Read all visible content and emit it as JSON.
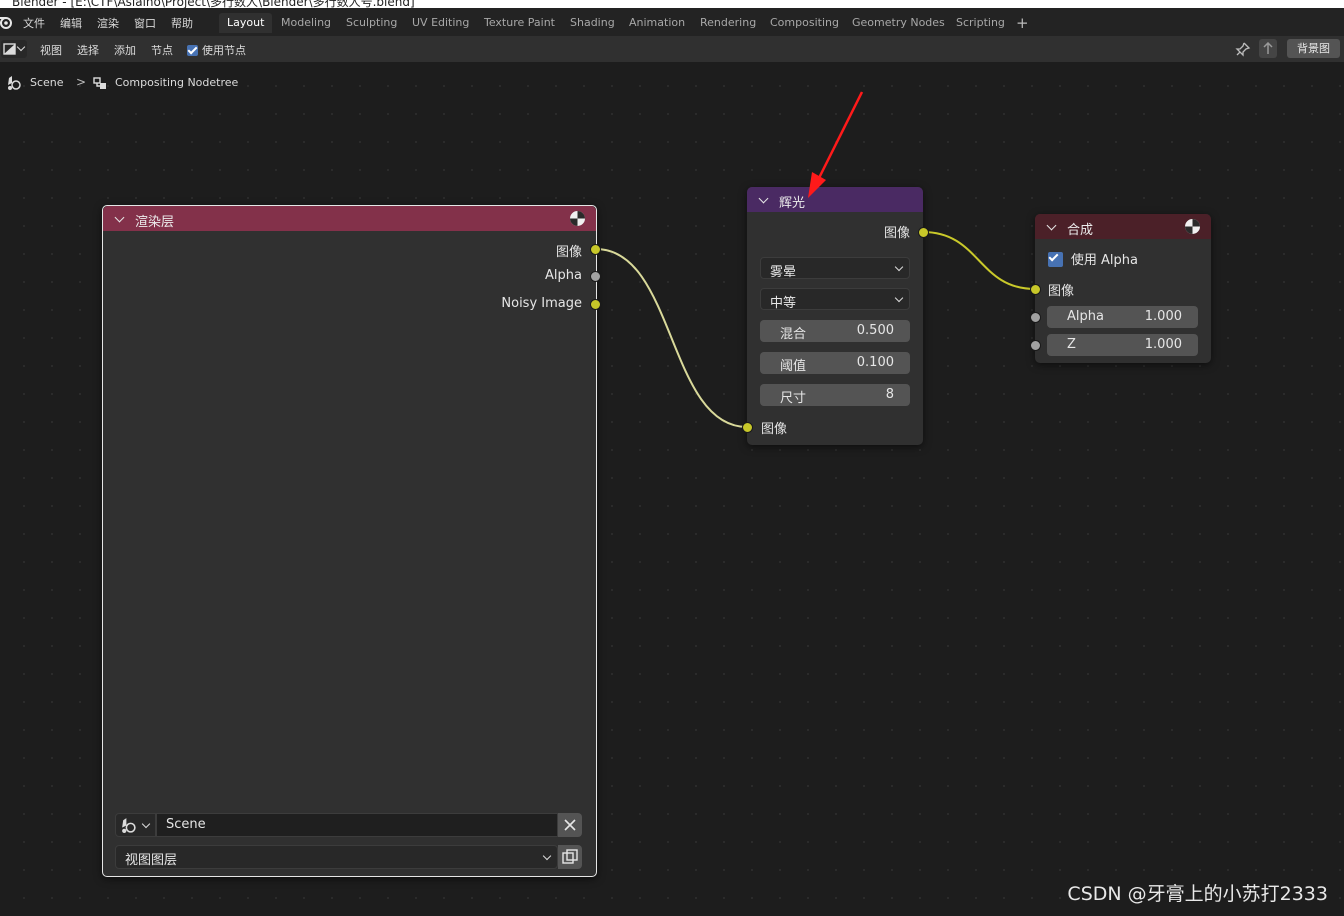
{
  "title_strip": "Blender - [E:\\CTF\\Asiaino\\Project\\多行数人\\Blender\\多行数人号.blend]",
  "menu": [
    "文件",
    "编辑",
    "渲染",
    "窗口",
    "帮助"
  ],
  "workspace_tabs": [
    {
      "label": "Layout",
      "active": true
    },
    {
      "label": "Modeling",
      "active": false
    },
    {
      "label": "Sculpting",
      "active": false
    },
    {
      "label": "UV Editing",
      "active": false
    },
    {
      "label": "Texture Paint",
      "active": false
    },
    {
      "label": "Shading",
      "active": false
    },
    {
      "label": "Animation",
      "active": false
    },
    {
      "label": "Rendering",
      "active": false
    },
    {
      "label": "Compositing",
      "active": false
    },
    {
      "label": "Geometry Nodes",
      "active": false
    },
    {
      "label": "Scripting",
      "active": false
    }
  ],
  "add_workspace": "+",
  "header": {
    "menus": [
      "视图",
      "选择",
      "添加",
      "节点"
    ],
    "use_nodes_label": "使用节点",
    "use_nodes_checked": true,
    "backdrop_label": "背景图"
  },
  "breadcrumb": {
    "scene": "Scene",
    "separator": ">",
    "nodetree": "Compositing Nodetree"
  },
  "nodes": {
    "render_layers": {
      "title": "渲染层",
      "header_color": "#83314a",
      "outputs": [
        "图像",
        "Alpha",
        "Noisy Image"
      ],
      "scene_value": "Scene",
      "view_layer_value": "视图图层"
    },
    "glare": {
      "title": "辉光",
      "header_color": "#4a2a63",
      "output": "图像",
      "glare_type": "雾晕",
      "quality": "中等",
      "fields": [
        {
          "label": "混合",
          "value": "0.500"
        },
        {
          "label": "阈值",
          "value": "0.100"
        },
        {
          "label": "尺寸",
          "value": "8"
        }
      ],
      "input": "图像"
    },
    "composite": {
      "title": "合成",
      "header_color": "#4b2028",
      "use_alpha_label": "使用 Alpha",
      "use_alpha_checked": true,
      "input_image": "图像",
      "fields": [
        {
          "label": "Alpha",
          "value": "1.000"
        },
        {
          "label": "Z",
          "value": "1.000"
        }
      ]
    }
  },
  "colors": {
    "socket_color": "#c7c729",
    "link_color": "#d9d99a",
    "annotation_arrow": "#ff1a1a"
  },
  "watermark": "CSDN @牙膏上的小苏打2333"
}
